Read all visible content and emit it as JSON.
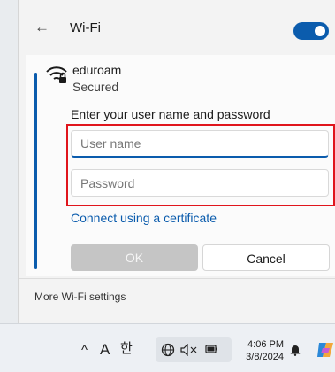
{
  "header": {
    "back_glyph": "←",
    "title": "Wi-Fi",
    "wifi_enabled": true
  },
  "network": {
    "icon": "wifi-secured-icon",
    "name": "eduroam",
    "status": "Secured",
    "prompt": "Enter your user name and password",
    "username": {
      "value": "",
      "placeholder": "User name"
    },
    "password": {
      "value": "",
      "placeholder": "Password"
    },
    "certificate_link": "Connect using a certificate",
    "ok_label": "OK",
    "cancel_label": "Cancel"
  },
  "footer": {
    "more_settings": "More Wi-Fi settings"
  },
  "taskbar": {
    "chevron": "^",
    "ime_letter": "A",
    "ime_hangul": "한",
    "time": "4:06 PM",
    "date": "3/8/2024"
  },
  "colors": {
    "accent": "#0b5cad",
    "highlight": "#e0151c"
  }
}
